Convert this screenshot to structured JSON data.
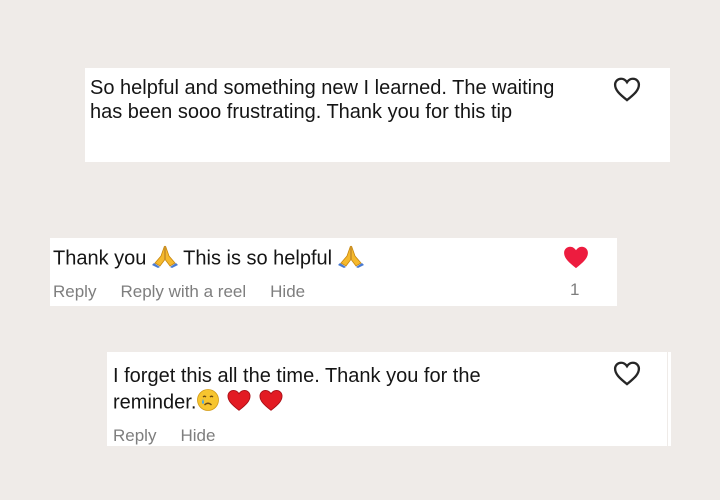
{
  "comments": [
    {
      "text": "So helpful and something new I learned. The waiting has been sooo frustrating. Thank you for this tip",
      "liked": false
    },
    {
      "text_part1": "Thank you",
      "text_part2": "This is so helpful",
      "emoji": "folded-hands",
      "liked": true,
      "like_count": "1",
      "actions": {
        "reply": "Reply",
        "reply_reel": "Reply with a reel",
        "hide": "Hide"
      }
    },
    {
      "text_line1": "I forget this all the time. Thank you for the",
      "text_line2": "reminder.",
      "emojis": [
        "crying-face",
        "red-heart",
        "red-heart"
      ],
      "liked": false,
      "actions": {
        "reply": "Reply",
        "hide": "Hide"
      }
    }
  ],
  "colors": {
    "background": "#efebe8",
    "heart_liked": "#ed1c3f",
    "action_text": "#7e7e7e"
  }
}
